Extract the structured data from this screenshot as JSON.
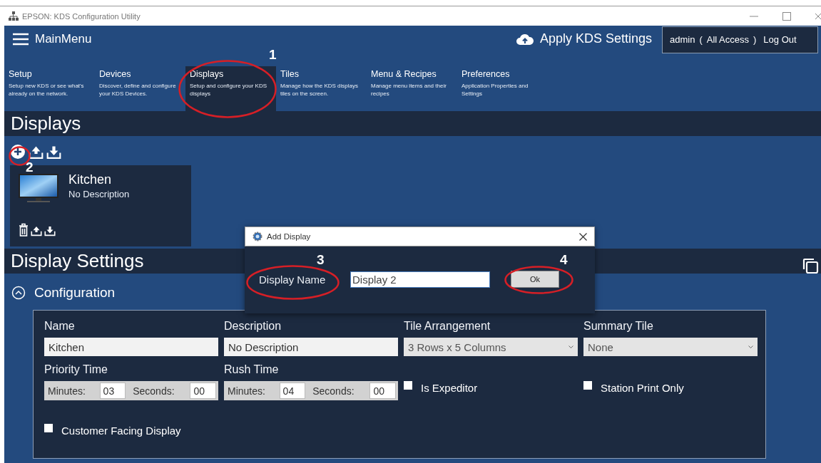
{
  "window": {
    "title": "EPSON: KDS Configuration Utility"
  },
  "header": {
    "menu_label": "MainMenu",
    "apply_label": "Apply KDS Settings",
    "user": "admin",
    "open_paren": "(",
    "access": "All Access",
    "close_paren": ")",
    "logout": "Log Out"
  },
  "nav_tabs": [
    {
      "title": "Setup",
      "description": "Setup new KDS or see what's already on the network.",
      "selected": false
    },
    {
      "title": "Devices",
      "description": "Discover, define and configure your KDS Devices.",
      "selected": false
    },
    {
      "title": "Displays",
      "description": "Setup and configure your KDS displays",
      "selected": true
    },
    {
      "title": "Tiles",
      "description": "Manage how the KDS displays tiles on the screen.",
      "selected": false
    },
    {
      "title": "Menu & Recipes",
      "description": "Manage menu items and their recipes",
      "selected": false
    },
    {
      "title": "Preferences",
      "description": "Application Properties and Settings",
      "selected": false
    }
  ],
  "displays_section": {
    "title": "Displays"
  },
  "display_cards": [
    {
      "name": "Kitchen",
      "description": "No Description"
    }
  ],
  "settings": {
    "title": "Display Settings",
    "configuration": {
      "title": "Configuration",
      "expanded": true,
      "fields": [
        {
          "kind": "text",
          "label": "Name",
          "value": "Kitchen"
        },
        {
          "kind": "text",
          "label": "Description",
          "value": "No Description"
        },
        {
          "kind": "dropdown",
          "label": "Tile Arrangement",
          "value": "3 Rows x 5 Columns"
        },
        {
          "kind": "dropdown",
          "label": "Summary Tile",
          "value": "None"
        }
      ],
      "times": [
        {
          "label": "Priority Time",
          "minutes_label": "Minutes:",
          "minutes": "03",
          "seconds_label": "Seconds:",
          "seconds": "00"
        },
        {
          "label": "Rush Time",
          "minutes_label": "Minutes:",
          "minutes": "04",
          "seconds_label": "Seconds:",
          "seconds": "00"
        }
      ],
      "checkboxes": [
        {
          "label": "Is Expeditor",
          "checked": false
        },
        {
          "label": "Station Print Only",
          "checked": false
        },
        {
          "label": "Customer Facing Display",
          "checked": false
        }
      ]
    }
  },
  "dialog": {
    "title": "Add Display",
    "field_label": "Display Name",
    "field_value": "Display 2",
    "ok_label": "Ok"
  },
  "annotations": [
    {
      "label": "1"
    },
    {
      "label": "2"
    },
    {
      "label": "3"
    },
    {
      "label": "4"
    }
  ]
}
